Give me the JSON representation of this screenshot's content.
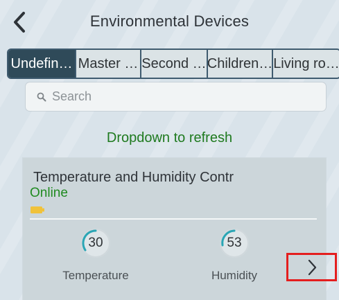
{
  "header": {
    "title": "Environmental Devices",
    "back_icon": "chevron-left-icon"
  },
  "tabs": [
    {
      "label": "Undefin…",
      "active": true
    },
    {
      "label": "Master …",
      "active": false
    },
    {
      "label": "Second …",
      "active": false
    },
    {
      "label": "Children…",
      "active": false
    },
    {
      "label": "Living ro…",
      "active": false
    }
  ],
  "search": {
    "placeholder": "Search",
    "value": "",
    "icon": "search-icon"
  },
  "refresh_hint": "Dropdown to refresh",
  "device": {
    "name": "Temperature and Humidity Contr",
    "status": "Online",
    "status_color": "#1f8a1f",
    "battery_icon": "battery-icon",
    "metrics": [
      {
        "label": "Temperature",
        "value": "30"
      },
      {
        "label": "Humidity",
        "value": "53"
      }
    ],
    "next_icon": "chevron-right-icon"
  },
  "colors": {
    "accent": "#2f4a59",
    "ring": "#2aa6b5",
    "highlight_box": "#e41e1e"
  }
}
